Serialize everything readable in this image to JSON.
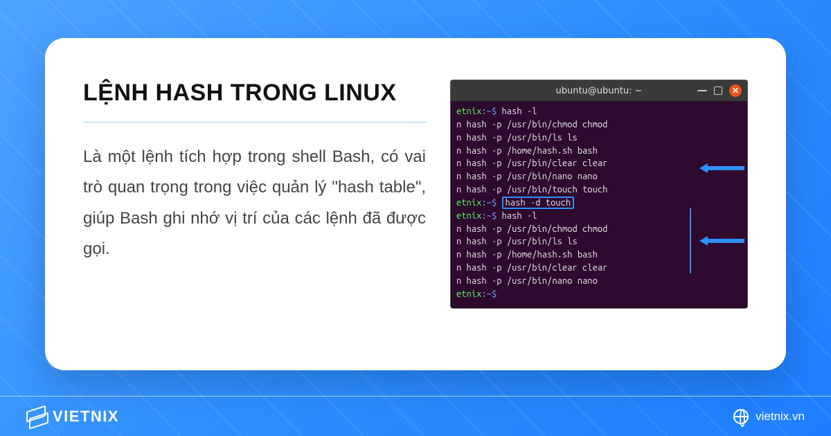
{
  "card": {
    "title": "LỆNH  HASH TRONG LINUX",
    "description": "Là một lệnh tích hợp trong shell Bash, có vai trò quan trọng trong việc quản lý \"hash table\", giúp Bash ghi nhớ vị trí của các lệnh đã được gọi."
  },
  "terminal": {
    "title": "ubuntu@ubuntu: ~",
    "prompt_user": "etnix",
    "prompt_path": ":~$",
    "output_prefix": "n hash -p",
    "commands": {
      "cmd1": "hash -l",
      "cmd2": "hash -d touch",
      "cmd3": "hash -l"
    },
    "block1": [
      "/usr/bin/chmod chmod",
      "/usr/bin/ls ls",
      "/home/hash.sh bash",
      "/usr/bin/clear clear",
      "/usr/bin/nano nano",
      "/usr/bin/touch touch"
    ],
    "block2": [
      "/usr/bin/chmod chmod",
      "/usr/bin/ls ls",
      "/home/hash.sh bash",
      "/usr/bin/clear clear",
      "/usr/bin/nano nano"
    ]
  },
  "footer": {
    "brand": "VIETNIX",
    "site": "vietnix.vn"
  },
  "colors": {
    "accent": "#2e8fff",
    "terminal_bg": "#2d0a2e",
    "close_btn": "#e95420"
  }
}
